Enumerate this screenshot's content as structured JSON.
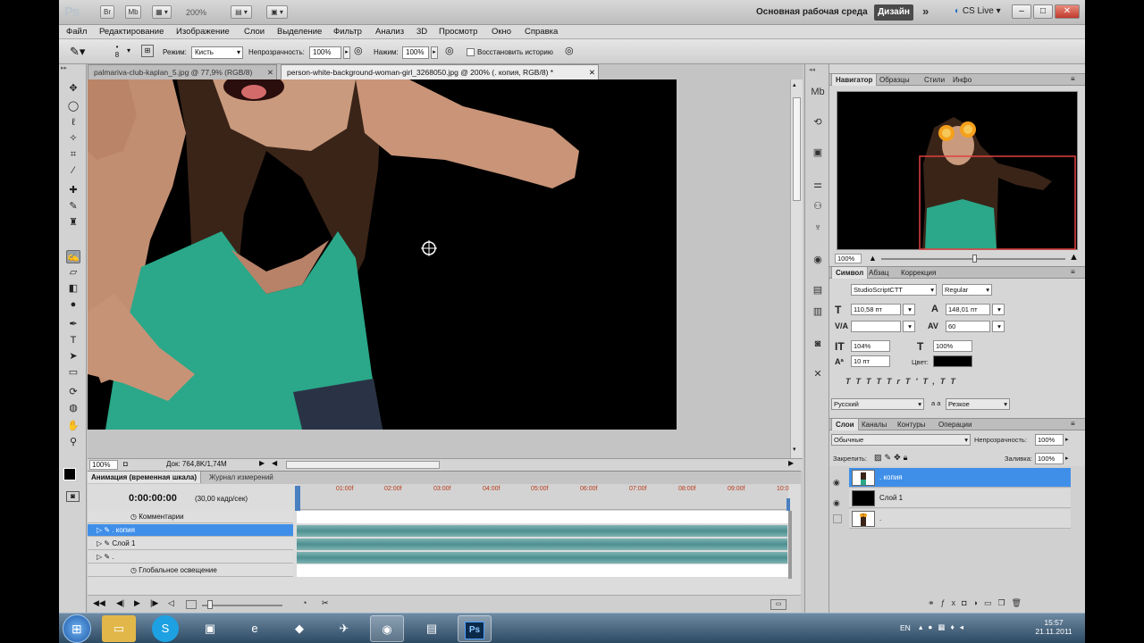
{
  "appbar": {
    "logo": "Ps",
    "b1": "Br",
    "b2": "Mb",
    "zoom": "200%",
    "workspace": "Основная рабочая среда",
    "design": "Дизайн",
    "more": "»",
    "cslive": "CS Live",
    "min": "–",
    "max": "□",
    "close": "✕"
  },
  "menu": [
    "Файл",
    "Редактирование",
    "Изображение",
    "Слои",
    "Выделение",
    "Фильтр",
    "Анализ",
    "3D",
    "Просмотр",
    "Окно",
    "Справка"
  ],
  "options": {
    "size": "8",
    "mode_label": "Режим:",
    "mode_value": "Кисть",
    "opacity_label": "Непрозрачность:",
    "opacity_value": "100%",
    "flow_label": "Нажим:",
    "flow_value": "100%",
    "restore_label": "Восстановить историю"
  },
  "tabs": [
    {
      "label": "palmariva-club-kaplan_5.jpg @ 77,9% (RGB/8)",
      "active": false
    },
    {
      "label": "person-white-background-woman-girl_3268050.jpg @ 200% (. копия, RGB/8) *",
      "active": true
    }
  ],
  "docstatus": {
    "zoom": "100%",
    "doc": "Док: 764,8K/1,74M"
  },
  "timeline": {
    "tab_active": "Анимация (временная шкала)",
    "tab_other": "Журнал измерений",
    "time": "0:00:00:00",
    "fps": "(30,00 кадр/сек)",
    "ruler": [
      "01:00f",
      "02:00f",
      "03:00f",
      "04:00f",
      "05:00f",
      "06:00f",
      "07:00f",
      "08:00f",
      "09:00f",
      "10:0"
    ],
    "rows": [
      {
        "label": "Комментарии",
        "type": "comment"
      },
      {
        "label": ". копия",
        "type": "layer",
        "selected": true
      },
      {
        "label": "Слой 1",
        "type": "layer",
        "selected": false
      },
      {
        "label": ".",
        "type": "layer",
        "selected": false
      },
      {
        "label": "Глобальное освещение",
        "type": "comment"
      }
    ]
  },
  "navigator": {
    "tabs": [
      "Навигатор",
      "Образцы",
      "Стили",
      "Инфо"
    ],
    "zoom": "100%"
  },
  "character": {
    "tabs": [
      "Символ",
      "Абзац",
      "Коррекция"
    ],
    "font": "StudioScriptCTT",
    "style": "Regular",
    "size": "110,58 пт",
    "leading": "148,01 пт",
    "kerning": "",
    "tracking": "60",
    "vscale": "104%",
    "hscale": "100%",
    "baseline": "10 пт",
    "color_label": "Цвет:",
    "styles": [
      "T",
      "T",
      "TT",
      "Tr",
      "T'",
      "T,",
      "T",
      "T"
    ],
    "language": "Русский",
    "aa_label": "a a",
    "aa": "Резкое"
  },
  "layers": {
    "tabs": [
      "Слои",
      "Каналы",
      "Контуры",
      "Операции"
    ],
    "blend": "Обычные",
    "opacity_label": "Непрозрачность:",
    "opacity": "100%",
    "lock_label": "Закрепить:",
    "fill_label": "Заливка:",
    "fill": "100%",
    "items": [
      {
        "name": ". копия",
        "selected": true,
        "visible": true
      },
      {
        "name": "Слой 1",
        "selected": false,
        "visible": true
      },
      {
        "name": ".",
        "selected": false,
        "visible": false
      }
    ]
  },
  "taskbar": {
    "lang": "EN",
    "time": "15:57",
    "date": "21.11.2011"
  },
  "colors": {
    "selection": "#3f8fe9",
    "track": "#5e9a9b",
    "navbox": "#e04040"
  }
}
